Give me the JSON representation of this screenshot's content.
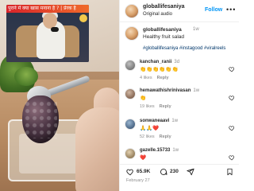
{
  "media": {
    "banner_text": "पुराने में क्या खास मनाना है ? | प्रेरक है"
  },
  "header": {
    "username": "globallifesaniya",
    "subtitle": "Original audio",
    "follow_label": "Follow",
    "more_label": "•••"
  },
  "caption": {
    "username": "globallifesaniya",
    "time": "1w",
    "text": "Healthy fruit salad",
    "tags": "#globallifesaniya #instagood #viralreels"
  },
  "comments": [
    {
      "user": "kanchan_ranii",
      "time": "3d",
      "text": "👏👏👏👏👏👏",
      "likes": "4 likes",
      "reply": "Reply"
    },
    {
      "user": "hemawathishrinivasan",
      "time": "1w",
      "text": "👏",
      "likes": "19 likes",
      "reply": "Reply"
    },
    {
      "user": "sonwaneaavi",
      "time": "1w",
      "text": "🙏🙏❤️",
      "likes": "52 likes",
      "reply": "Reply"
    },
    {
      "user": "gazelle.15733",
      "time": "1w",
      "text": "❤️",
      "likes": "",
      "reply": ""
    }
  ],
  "actions": {
    "likes": "65.9K",
    "comments": "230"
  },
  "date": "February 27",
  "colors": {
    "accent": "#0095f6",
    "hashtag": "#00376b",
    "muted": "#8e8e8e",
    "text": "#262626"
  }
}
